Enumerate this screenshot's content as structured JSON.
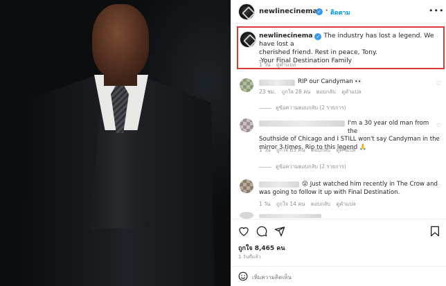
{
  "post": {
    "username": "newlinecinema",
    "separator": "•",
    "follow_label": "ติดตาม",
    "more_label": "•••",
    "caption": {
      "username": "newlinecinema",
      "line1": "The industry has lost a legend. We have lost a",
      "line2": "cherished friend. Rest in peace, Tony.",
      "line3": "-Your Final Destination Family",
      "time": "1 วัน",
      "translate": "ดูคำแปล"
    },
    "comments": [
      {
        "text_line1": "RIP our Candyman",
        "emoji": "👀",
        "text_line2": "",
        "time": "23 ชม.",
        "likes": "ถูกใจ 28 คน",
        "reply": "ตอบกลับ",
        "translate": "ดูคำแปล",
        "view_replies": "ดูข้อความตอบกลับ (2 รายการ)"
      },
      {
        "text_line1": "I'm a 30 year old man from the",
        "text_line2": "Southside of Chicago and I STILL won't say Candyman in the",
        "text_line3": "mirror 3 times. Rip to this legend 🙏",
        "time": "1 วัน",
        "likes": "ถูกใจ 63 คน",
        "reply": "ตอบกลับ",
        "translate": "ดูคำแปล",
        "view_replies": "ดูข้อความตอบกลับ (2 รายการ)"
      },
      {
        "text_line1": "😮 Just watched him recently in The Crow and",
        "text_line2": "was going to follow it up with Final Destination.",
        "time": "1 วัน",
        "likes": "ถูกใจ 14 คน",
        "reply": "ตอบกลับ",
        "translate": "ดูคำแปล"
      }
    ],
    "likes_count": "ถูกใจ 8,465 คน",
    "posted_time": "1 วันที่แล้ว",
    "comment_placeholder": "เพิ่มความคิดเห็น"
  },
  "icons": [
    "heart-icon",
    "comment-icon",
    "share-icon",
    "bookmark-icon",
    "emoji-icon",
    "verified-icon"
  ],
  "colors": {
    "highlight_border": "#d83a3a",
    "verified": "#3897f0",
    "follow": "#0095f6"
  }
}
